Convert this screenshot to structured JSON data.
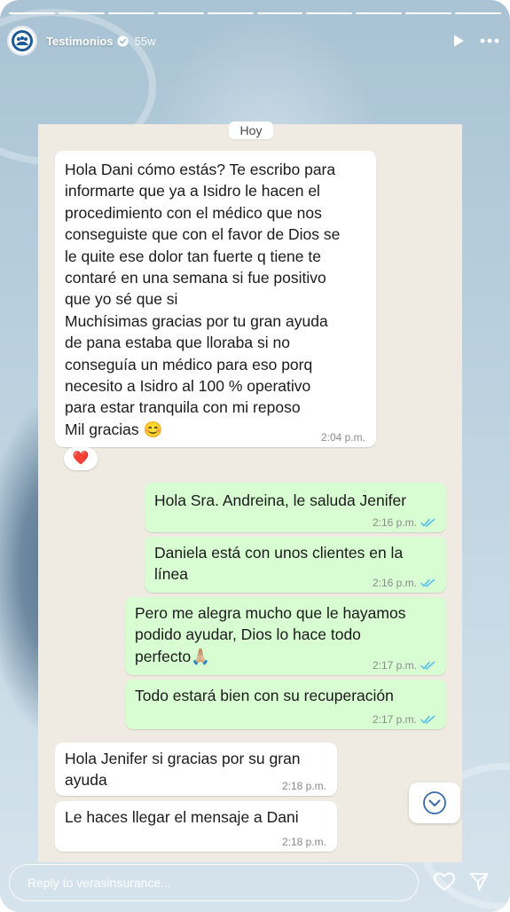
{
  "story": {
    "account_name": "Testimonios",
    "age": "55w",
    "segments": 10,
    "reply_placeholder": "Reply to verasinsurance..."
  },
  "chat": {
    "day_label": "Hoy",
    "reaction": "❤️",
    "messages": [
      {
        "side": "in",
        "text": "Hola Dani cómo estás? Te escribo para\ninformarte que ya a Isidro le hacen el\nprocedimiento con el médico que nos\nconseguiste que con el favor de Dios se\nle quite ese dolor tan fuerte q tiene te\ncontaré en una semana si fue positivo\nque yo sé que si\nMuchísimas gracias por tu gran ayuda\nde pana estaba que lloraba si no\nconseguía un médico para eso porq\nnecesito a Isidro al 100 % operativo\npara estar tranquila con mi reposo\nMil gracias 😊",
        "time": "2:04 p.m."
      },
      {
        "side": "out",
        "text": "Hola Sra. Andreina, le saluda Jenifer",
        "time": "2:16 p.m."
      },
      {
        "side": "out",
        "text": "Daniela está con unos clientes en la\nlínea",
        "time": "2:16 p.m."
      },
      {
        "side": "out",
        "text": "Pero me alegra mucho que le hayamos\npodido ayudar, Dios lo hace todo\nperfecto🙏🏼",
        "time": "2:17 p.m."
      },
      {
        "side": "out",
        "text": "Todo estará bien con su recuperación",
        "time": "2:17 p.m."
      },
      {
        "side": "in",
        "text": "Hola Jenifer si gracias por su gran\nayuda",
        "time": "2:18 p.m."
      },
      {
        "side": "in",
        "text": "Le haces llegar el mensaje a Dani",
        "time": "2:18 p.m."
      }
    ]
  },
  "colors": {
    "incoming_bubble": "#ffffff",
    "outgoing_bubble": "#d8fdd2",
    "chat_background": "#efeae2",
    "read_ticks": "#53bdeb"
  }
}
